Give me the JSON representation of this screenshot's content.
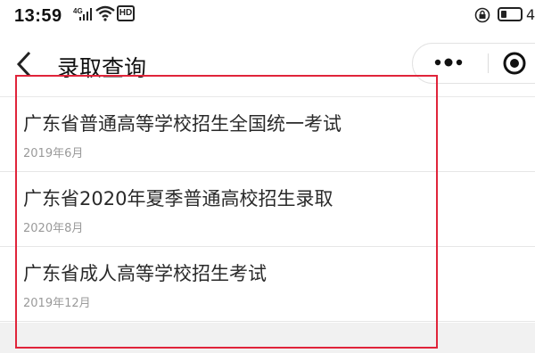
{
  "status_bar": {
    "time": "13:59",
    "network": "4G",
    "hd": "HD",
    "extra": "4"
  },
  "nav": {
    "back_icon": "chevron-left-icon",
    "title": "录取查询",
    "more_icon": "more-dots-icon",
    "close_icon": "target-icon"
  },
  "results": [
    {
      "title": "广东省普通高等学校招生全国统一考试",
      "date": "2019年6月"
    },
    {
      "title": "广东省2020年夏季普通高校招生录取",
      "date": "2020年8月"
    },
    {
      "title": "广东省成人高等学校招生考试",
      "date": "2019年12月"
    }
  ],
  "colors": {
    "highlight": "#e0243a",
    "divider": "#e6e6e6",
    "date_text": "#9a9a9a"
  }
}
